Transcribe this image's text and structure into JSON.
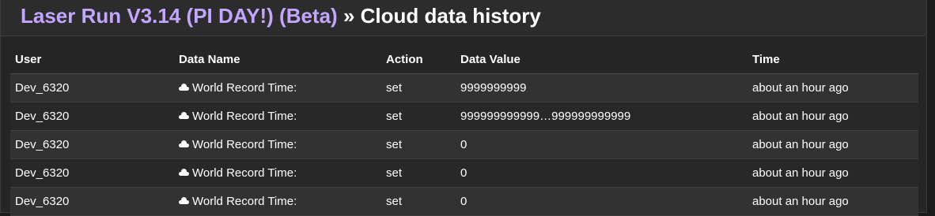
{
  "header": {
    "project_name": "Laser Run V3.14 (PI DAY!) (Beta)",
    "separator": "»",
    "page_title": "Cloud data history"
  },
  "table": {
    "columns": [
      "User",
      "Data Name",
      "Action",
      "Data Value",
      "Time"
    ],
    "rows": [
      {
        "user": "Dev_6320",
        "data_name": "World Record Time:",
        "action": "set",
        "value": "9999999999",
        "time": "about an hour ago"
      },
      {
        "user": "Dev_6320",
        "data_name": "World Record Time:",
        "action": "set",
        "value": "999999999999…999999999999",
        "time": "about an hour ago"
      },
      {
        "user": "Dev_6320",
        "data_name": "World Record Time:",
        "action": "set",
        "value": "0",
        "time": "about an hour ago"
      },
      {
        "user": "Dev_6320",
        "data_name": "World Record Time:",
        "action": "set",
        "value": "0",
        "time": "about an hour ago"
      },
      {
        "user": "Dev_6320",
        "data_name": "World Record Time:",
        "action": "set",
        "value": "0",
        "time": "about an hour ago"
      }
    ]
  },
  "colors": {
    "project_link": "#c3a6ff",
    "text": "#ffffff",
    "background": "#252525"
  }
}
